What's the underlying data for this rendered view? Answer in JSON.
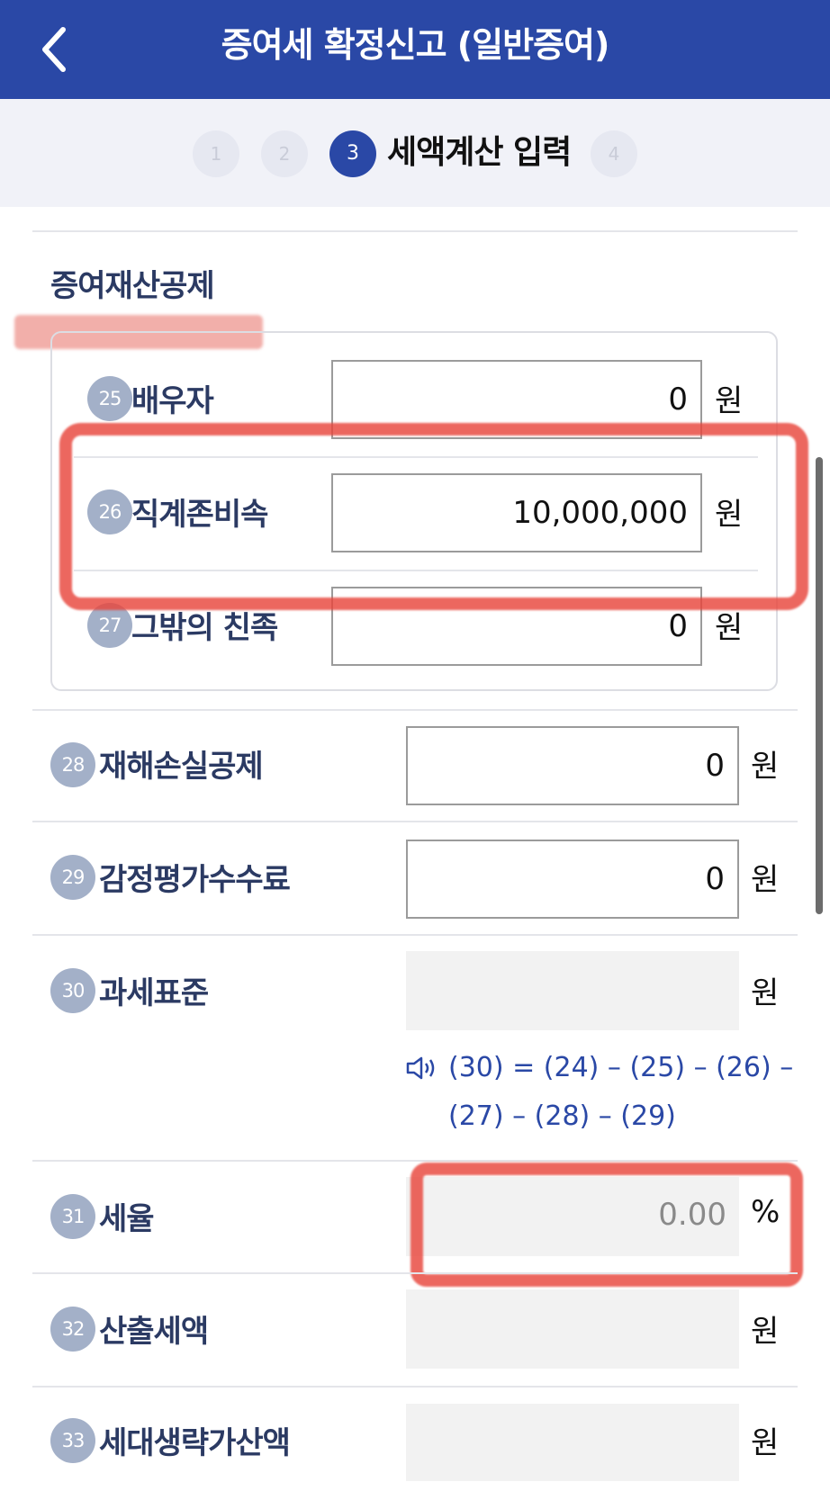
{
  "header": {
    "title": "증여세 확정신고 (일반증여)",
    "back_icon": "chevron-left-icon"
  },
  "steps": {
    "items": [
      "1",
      "2",
      "3",
      "4"
    ],
    "active_index": 2,
    "active_label": "세액계산 입력"
  },
  "section": {
    "title": "증여재산공제"
  },
  "group_rows": [
    {
      "num": "25",
      "label": "배우자",
      "value": "0",
      "unit": "원"
    },
    {
      "num": "26",
      "label": "직계존비속",
      "value": "10,000,000",
      "unit": "원"
    },
    {
      "num": "27",
      "label": "그밖의 친족",
      "value": "0",
      "unit": "원"
    }
  ],
  "rows": [
    {
      "num": "28",
      "label": "재해손실공제",
      "value": "0",
      "unit": "원"
    },
    {
      "num": "29",
      "label": "감정평가수수료",
      "value": "0",
      "unit": "원"
    },
    {
      "num": "30",
      "label": "과세표준",
      "value": "",
      "unit": "원"
    },
    {
      "num": "31",
      "label": "세율",
      "value": "0.00",
      "unit": "%"
    },
    {
      "num": "32",
      "label": "산출세액",
      "value": "",
      "unit": "원"
    },
    {
      "num": "33",
      "label": "세대생략가산액",
      "value": "",
      "unit": "원"
    }
  ],
  "formula": {
    "icon": "speaker-icon",
    "line1": "(30) = (24) – (25) – (26) –",
    "line2": "(27) – (28) – (29)"
  },
  "colors": {
    "header_bg": "#2a48a6",
    "label": "#2b3a63",
    "badge": "#a3b0c8",
    "annotation_red": "#e8463c"
  }
}
